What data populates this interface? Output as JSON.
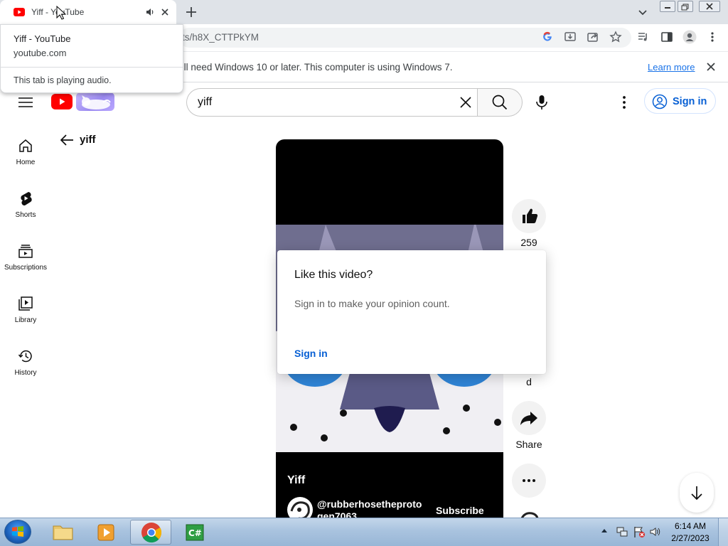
{
  "browser": {
    "tab_title": "Yiff - YouTube",
    "url": "ts/h8X_CTTPkYM",
    "infobar_text": "'ll need Windows 10 or later. This computer is using Windows 7.",
    "infobar_link": "Learn more"
  },
  "hovercard": {
    "title": "Yiff - YouTube",
    "domain": "youtube.com",
    "audio_status": "This tab is playing audio."
  },
  "masthead": {
    "search_value": "yiff",
    "sign_in_label": "Sign in"
  },
  "sidebar": {
    "items": [
      {
        "label": "Home",
        "icon": "home-icon"
      },
      {
        "label": "Shorts",
        "icon": "shorts-icon"
      },
      {
        "label": "Subscriptions",
        "icon": "subscriptions-icon"
      },
      {
        "label": "Library",
        "icon": "library-icon"
      },
      {
        "label": "History",
        "icon": "history-icon"
      }
    ]
  },
  "shorts": {
    "query": "yiff",
    "video_title": "Yiff",
    "channel_name": "@rubberhosetheprotogen7063",
    "subscribe_label": "Subscribe"
  },
  "actions": {
    "like_count": "259",
    "dislike_label": "d",
    "share_label": "Share"
  },
  "popup": {
    "title": "Like this video?",
    "body": "Sign in to make your opinion count.",
    "sign_in": "Sign in"
  },
  "taskbar": {
    "time": "6:14 AM",
    "date": "2/27/2023"
  },
  "colors": {
    "youtube_red": "#ff0000",
    "link_blue": "#065fd4",
    "chrome_blue": "#1a73e8"
  }
}
